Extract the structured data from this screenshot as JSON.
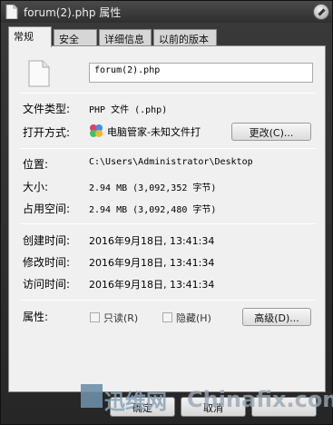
{
  "window": {
    "title": "forum(2).php 属性"
  },
  "tabs": [
    {
      "label": "常规",
      "active": true
    },
    {
      "label": "安全",
      "active": false
    },
    {
      "label": "详细信息",
      "active": false
    },
    {
      "label": "以前的版本",
      "active": false
    }
  ],
  "general": {
    "file_name": "forum(2).php",
    "file_type_label": "文件类型:",
    "file_type_value": "PHP 文件 (.php)",
    "opens_with_label": "打开方式:",
    "opens_with_value": "电脑管家-未知文件打",
    "change_button": "更改(C)...",
    "location_label": "位置:",
    "location_value": "C:\\Users\\Administrator\\Desktop",
    "size_label": "大小:",
    "size_value": "2.94 MB (3,092,352 字节)",
    "size_on_disk_label": "占用空间:",
    "size_on_disk_value": "2.94 MB (3,092,480 字节)",
    "created_label": "创建时间:",
    "created_value": "2016年9月18日, 13:41:34",
    "modified_label": "修改时间:",
    "modified_value": "2016年9月18日, 13:41:34",
    "accessed_label": "访问时间:",
    "accessed_value": "2016年9月18日, 13:41:34",
    "attributes_label": "属性:",
    "readonly_label": "只读(R)",
    "hidden_label": "隐藏(H)",
    "advanced_button": "高级(D)..."
  },
  "footer": {
    "ok_button": "确定",
    "cancel_button": "取消",
    "apply_button": ""
  },
  "watermark": {
    "cn": "迅维网",
    "en": "Chinafix.com"
  }
}
